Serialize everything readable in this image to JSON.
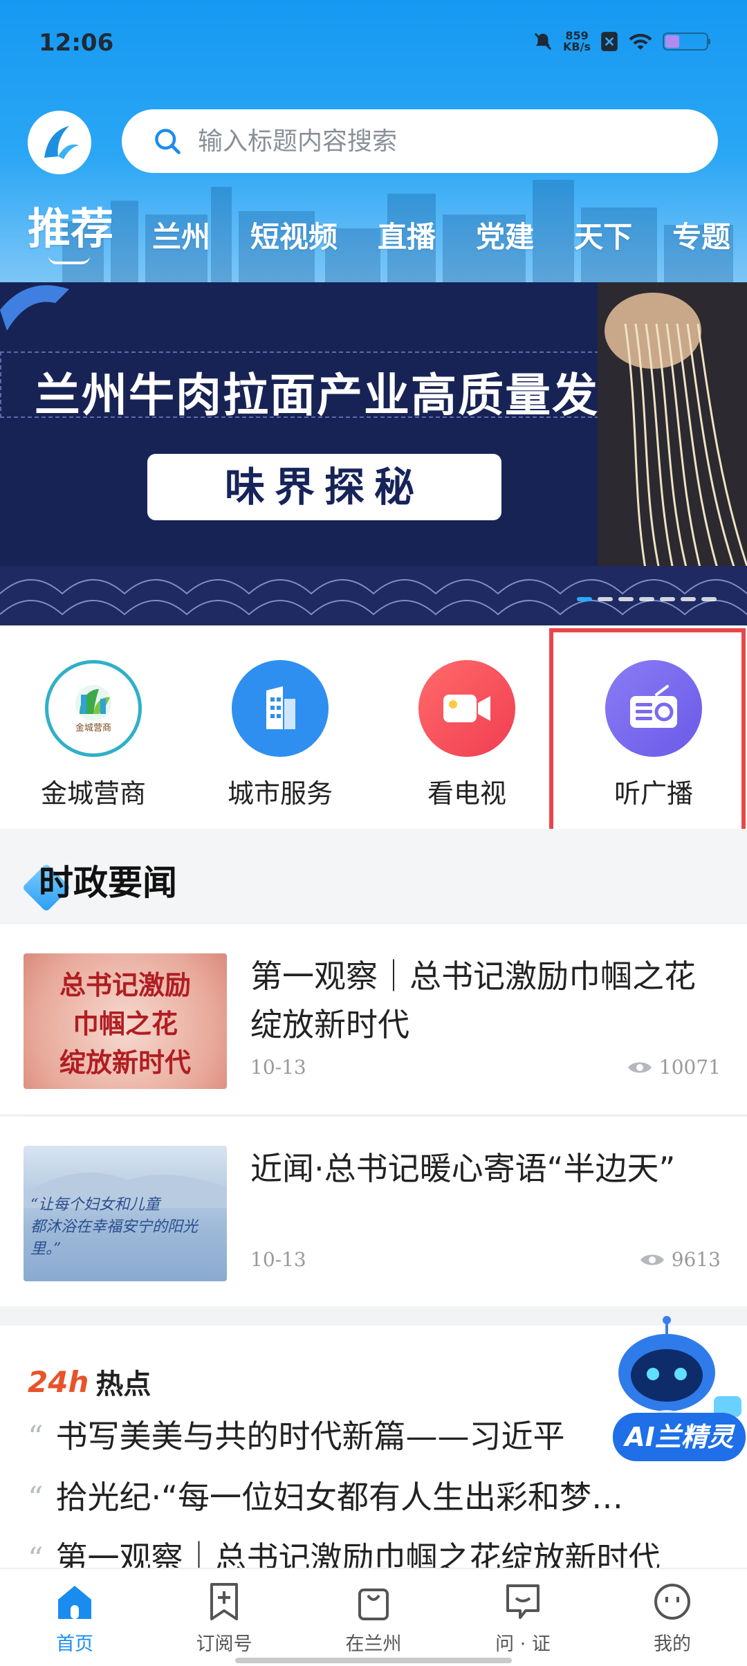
{
  "status_bar": {
    "time": "12:06",
    "net_speed": "859",
    "net_unit": "KB/s"
  },
  "header": {
    "search_placeholder": "输入标题内容搜索",
    "tabs": [
      {
        "label": "推荐"
      },
      {
        "label": "兰州"
      },
      {
        "label": "短视频"
      },
      {
        "label": "直播"
      },
      {
        "label": "党建"
      },
      {
        "label": "天下"
      },
      {
        "label": "专题"
      }
    ]
  },
  "banner": {
    "title": "兰州牛肉拉面产业高质量发展之",
    "button": "味界探秘",
    "slide_count": 7,
    "active_slide": 1
  },
  "shortcuts": [
    {
      "label": "金城营商",
      "icon": "jincheng-logo-icon",
      "icon_text": "金城营商"
    },
    {
      "label": "城市服务",
      "icon": "building-icon"
    },
    {
      "label": "看电视",
      "icon": "video-camera-icon"
    },
    {
      "label": "听广播",
      "icon": "radio-icon"
    }
  ],
  "section": {
    "title": "时政要闻"
  },
  "news": [
    {
      "title": "第一观察｜总书记激励巾帼之花绽放新时代",
      "date": "10-13",
      "views": "10071",
      "thumb_text": [
        "总书记激励",
        "巾帼之花",
        "绽放新时代"
      ]
    },
    {
      "title": "近闻·总书记暖心寄语“半边天”",
      "date": "10-13",
      "views": "9613",
      "thumb_text": [
        "“让每个妇女和儿童",
        "都沐浴在幸福安宁的阳光里。”"
      ]
    }
  ],
  "hot": {
    "logo_24": "24h",
    "logo_text": "热点",
    "items": [
      {
        "text": "书写美美与共的时代新篇——习近平"
      },
      {
        "text": "拾光纪·“每一位妇女都有人生出彩和梦…"
      },
      {
        "text": "第一观察｜总书记激励巾帼之花绽放新时代"
      }
    ]
  },
  "ai_badge": "AI兰精灵",
  "bottom_nav": [
    {
      "label": "首页",
      "icon": "home-icon",
      "active": true
    },
    {
      "label": "订阅号",
      "icon": "bookmark-plus-icon",
      "active": false
    },
    {
      "label": "在兰州",
      "icon": "bag-icon",
      "active": false
    },
    {
      "label": "问 · 证",
      "icon": "chat-icon",
      "active": false
    },
    {
      "label": "我的",
      "icon": "smile-icon",
      "active": false
    }
  ],
  "colors": {
    "accent": "#1a8cf0",
    "header_blue": "#1699f2",
    "highlight_red": "#e8474a",
    "banner_navy": "#182355"
  }
}
